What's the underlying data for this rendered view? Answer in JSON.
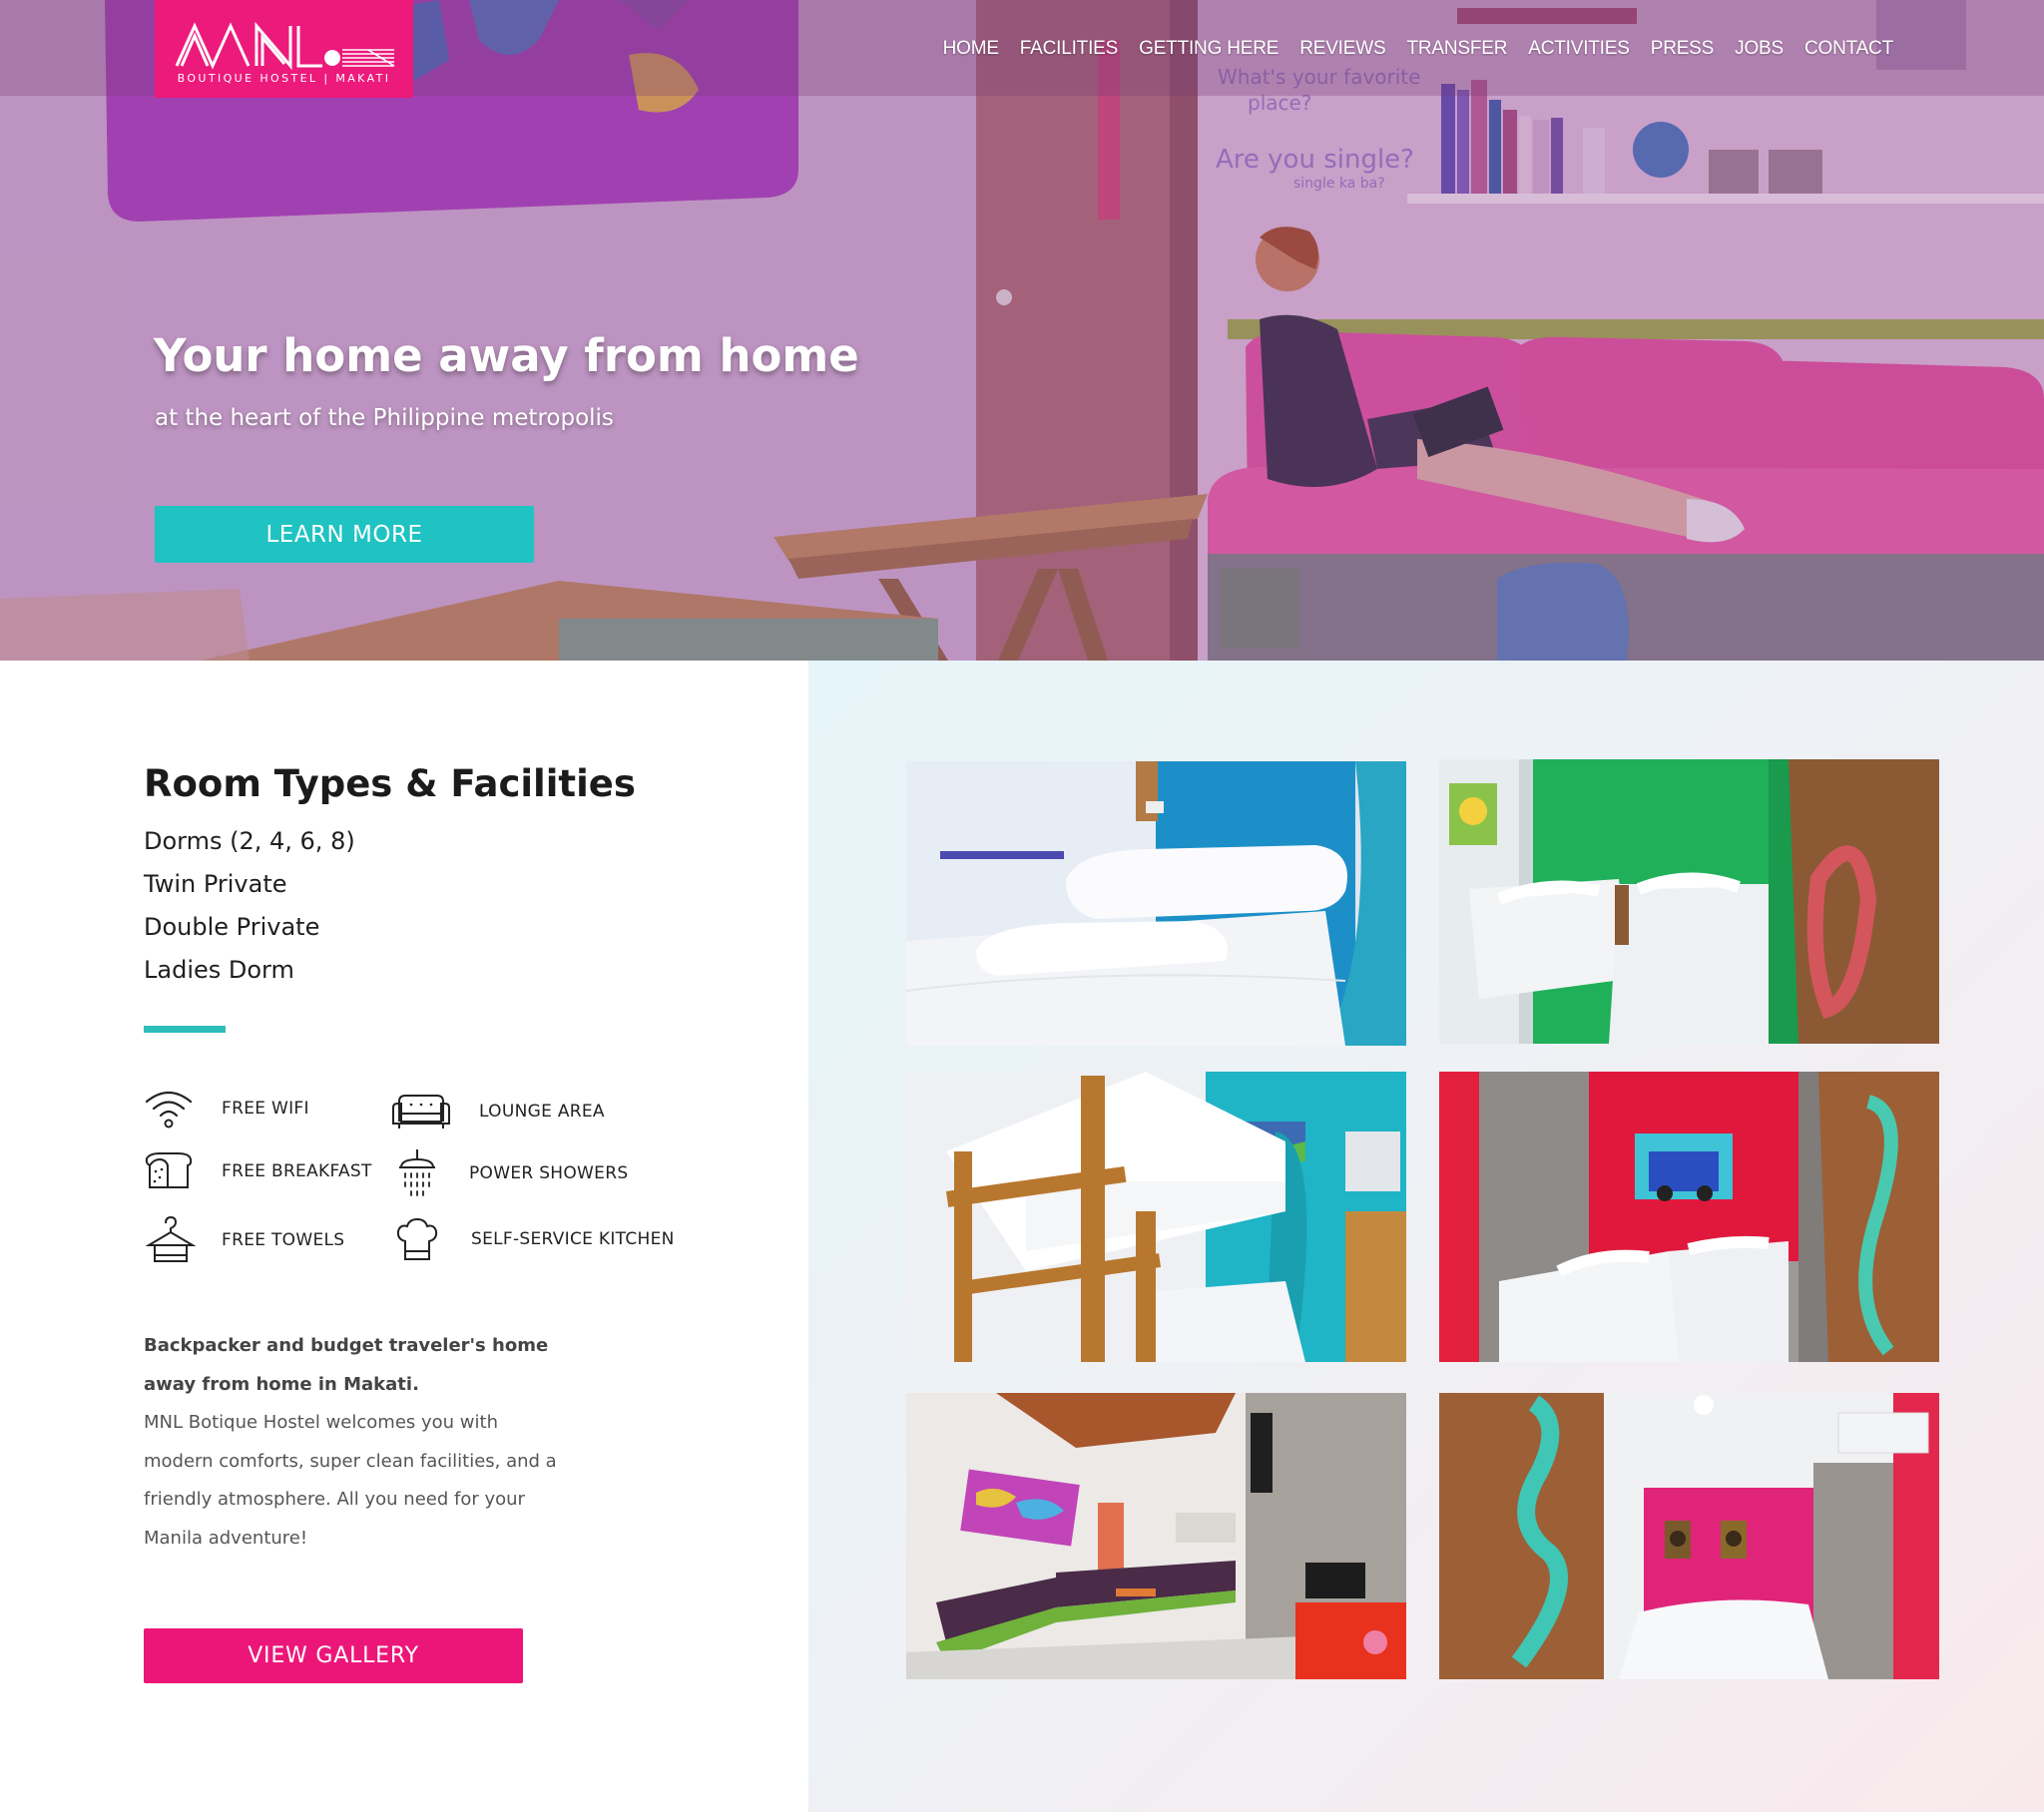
{
  "brand": {
    "logo_text": "MNL",
    "logo_subtitle": "BOUTIQUE HOSTEL | MAKATI",
    "brand_pink": "#ec1a7b",
    "accent_teal": "#1fc3c2"
  },
  "nav": {
    "items": [
      {
        "label": "HOME"
      },
      {
        "label": "FACILITIES"
      },
      {
        "label": "GETTING HERE"
      },
      {
        "label": "REVIEWS"
      },
      {
        "label": "TRANSFER"
      },
      {
        "label": "ACTIVITIES"
      },
      {
        "label": "PRESS"
      },
      {
        "label": "JOBS"
      },
      {
        "label": "CONTACT"
      }
    ]
  },
  "hero": {
    "title": "Your home away from home",
    "subtitle": "at the heart of the Philippine metropolis",
    "cta_label": "LEARN MORE",
    "wall_text": {
      "line1": "What's your favorite",
      "line2": "place?",
      "line3": "Are you single?",
      "line4": "single ka ba?"
    }
  },
  "rooms": {
    "title": "Room Types & Facilities",
    "types": [
      "Dorms (2, 4, 6, 8)",
      "Twin Private",
      "Double Private",
      "Ladies Dorm"
    ]
  },
  "facilities": [
    {
      "label": "FREE WIFI",
      "icon": "wifi-icon"
    },
    {
      "label": "LOUNGE AREA",
      "icon": "sofa-icon"
    },
    {
      "label": "FREE BREAKFAST",
      "icon": "bread-icon"
    },
    {
      "label": "POWER SHOWERS",
      "icon": "shower-icon"
    },
    {
      "label": "FREE TOWELS",
      "icon": "hanger-towel-icon"
    },
    {
      "label": "SELF-SERVICE KITCHEN",
      "icon": "chef-hat-icon"
    }
  ],
  "description": {
    "bold": "Backpacker and budget traveler's home away from home in Makati.",
    "body": "MNL Botique Hostel welcomes you with modern comforts, super clean facilities, and a friendly atmosphere. All you need for your Manila adventure!"
  },
  "gallery": {
    "cta_label": "VIEW GALLERY",
    "photos": [
      {
        "name": "dorm-bed-photo"
      },
      {
        "name": "green-twin-room-photo"
      },
      {
        "name": "bunk-bed-photo"
      },
      {
        "name": "red-twin-room-photo"
      },
      {
        "name": "lounge-area-photo"
      },
      {
        "name": "pink-double-room-photo"
      }
    ]
  }
}
